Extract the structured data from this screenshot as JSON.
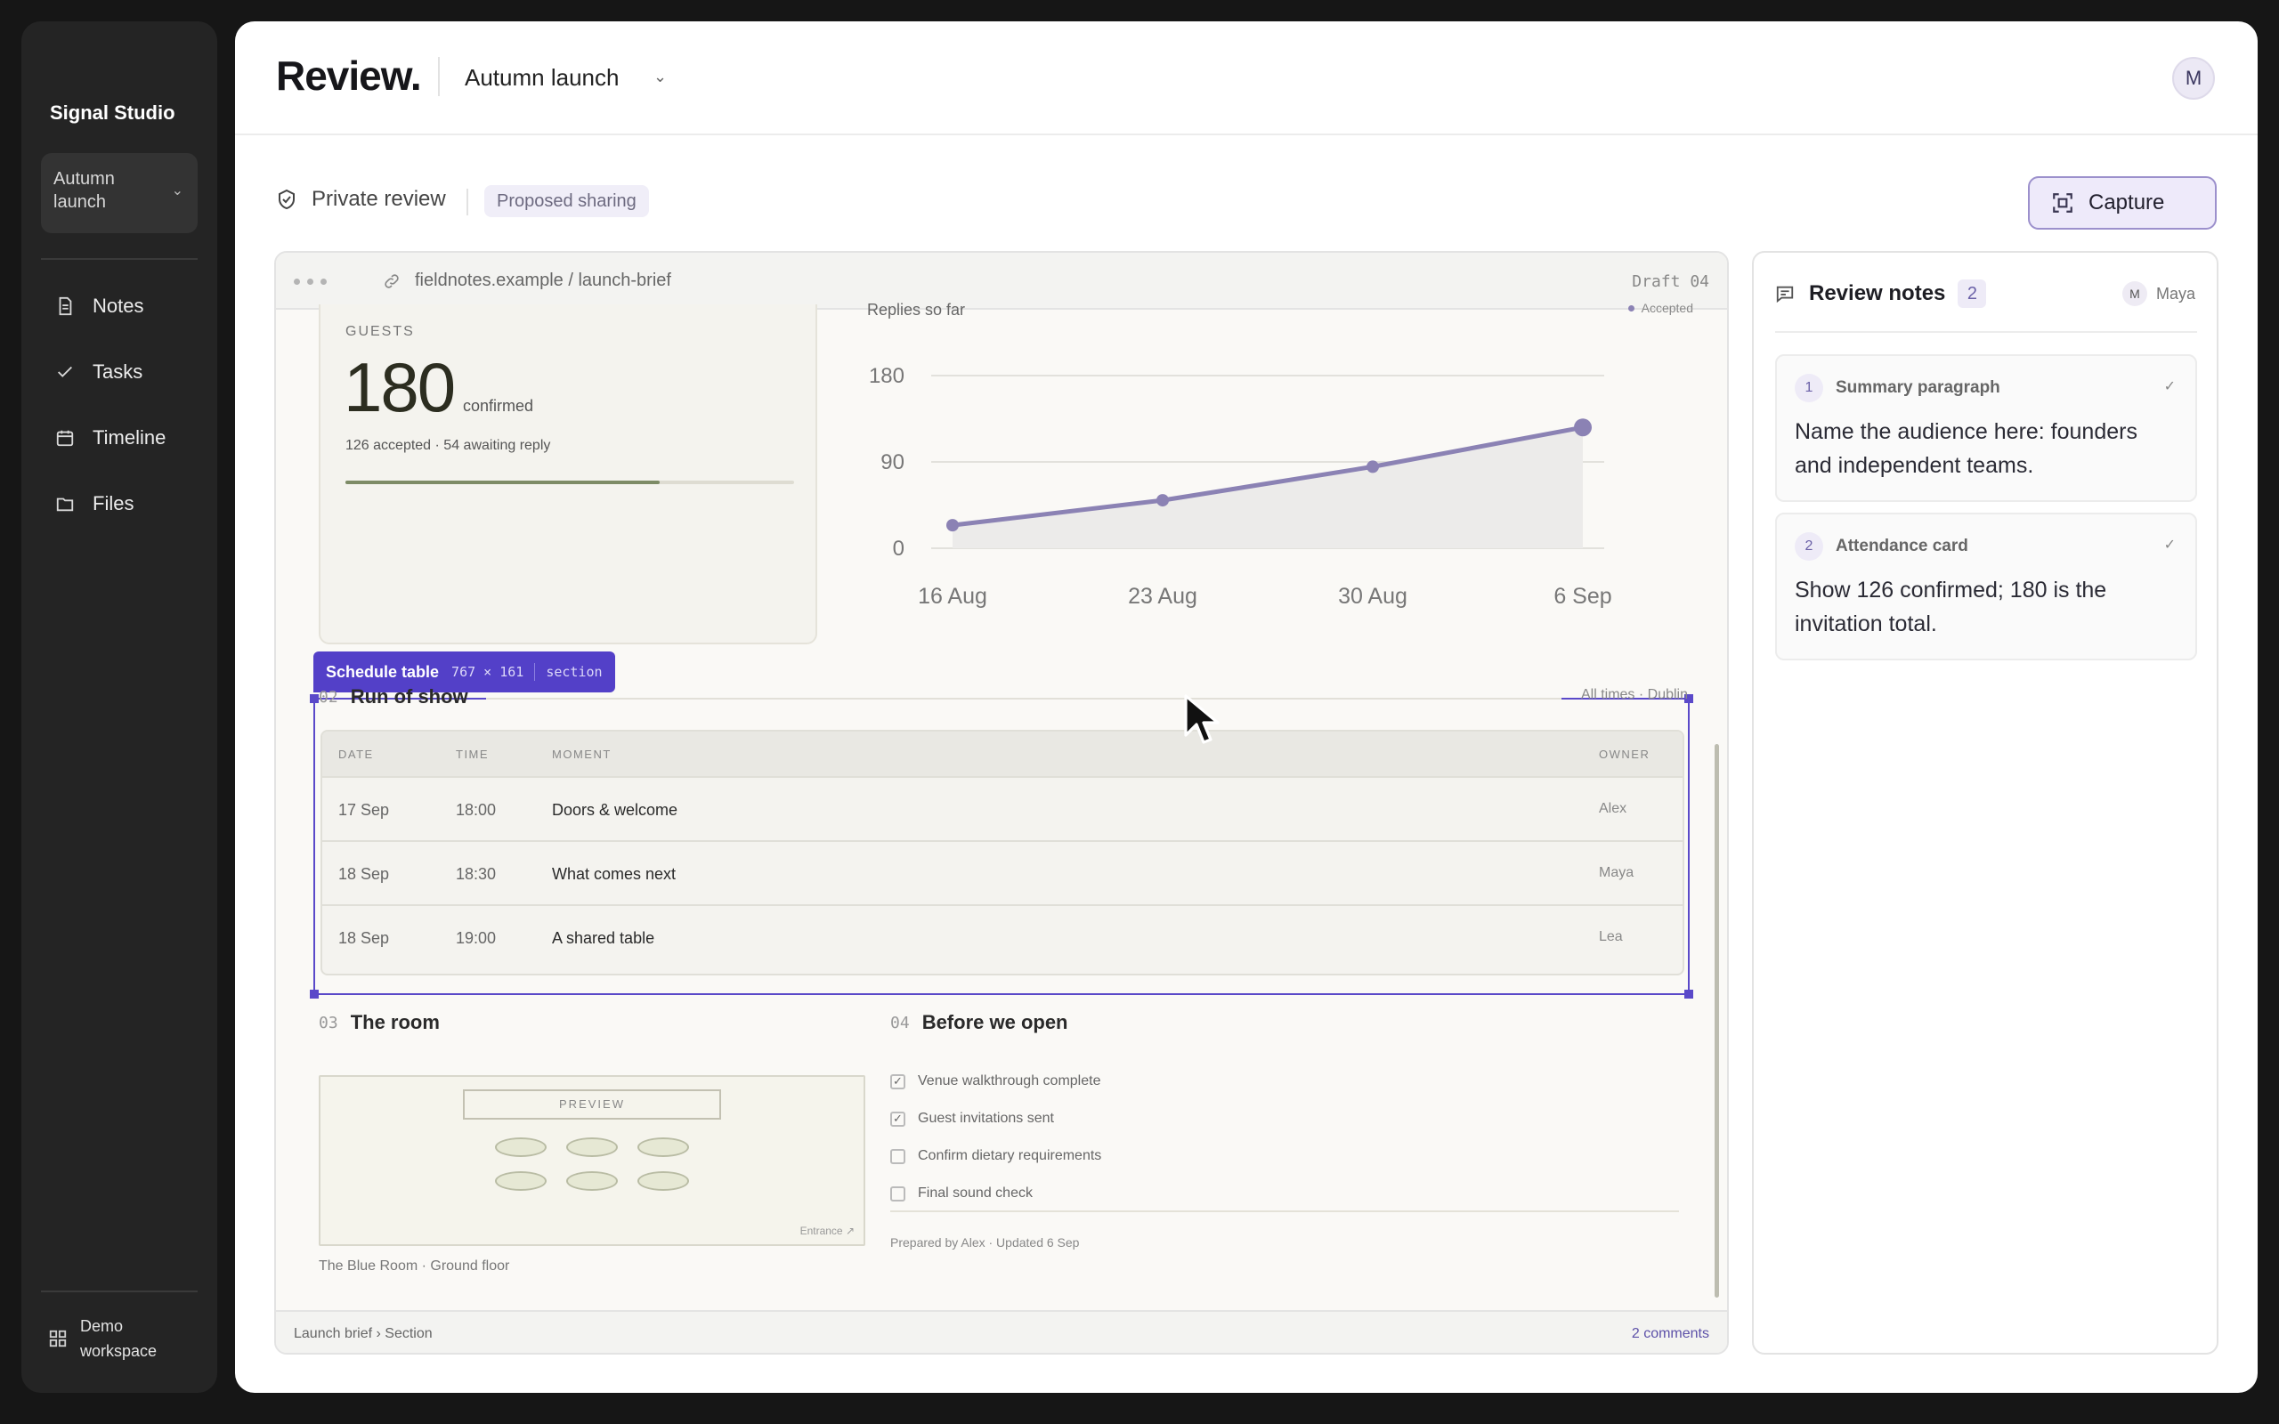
{
  "sidebar": {
    "brand": "Signal Studio",
    "project": "Autumn launch",
    "items": [
      {
        "label": "Notes",
        "icon": "document-icon"
      },
      {
        "label": "Tasks",
        "icon": "check-icon"
      },
      {
        "label": "Timeline",
        "icon": "calendar-icon"
      },
      {
        "label": "Files",
        "icon": "folder-icon"
      }
    ],
    "workspace": "Demo workspace"
  },
  "header": {
    "title": "Review.",
    "project": "Autumn launch",
    "avatar": "M"
  },
  "toolbar": {
    "mode": "Private review",
    "badge": "Proposed sharing",
    "capture": "Capture"
  },
  "browser": {
    "url": "fieldnotes.example / launch-brief",
    "draft": "Draft 04",
    "breadcrumb": "Launch brief › Section",
    "comments": "2 comments"
  },
  "guests": {
    "label": "GUESTS",
    "total": "180",
    "total_suffix": "confirmed",
    "sub": "126 accepted  ·  54 awaiting reply",
    "progress": 0.7
  },
  "replies": {
    "title": "Replies so far",
    "legend": "Accepted"
  },
  "chart_data": {
    "type": "line",
    "title": "Replies so far",
    "categories": [
      "16 Aug",
      "23 Aug",
      "30 Aug",
      "6 Sep"
    ],
    "x": [
      0,
      7,
      14,
      21
    ],
    "y_ticks": [
      "180",
      "90",
      "0"
    ],
    "ylim": [
      0,
      180
    ],
    "series": [
      {
        "name": "Accepted",
        "values": [
          24,
          50,
          85,
          126
        ],
        "color": "#8b82b4"
      }
    ],
    "grid": true,
    "legend": "top-right"
  },
  "selection": {
    "name": "Schedule table",
    "size": "767 × 161",
    "kind": "section"
  },
  "schedule": {
    "num": "02",
    "title": "Run of show",
    "note": "All times · Dublin",
    "columns": [
      "DATE",
      "TIME",
      "MOMENT",
      "OWNER"
    ],
    "rows": [
      {
        "date": "17 Sep",
        "time": "18:00",
        "moment": "Doors & welcome",
        "owner": "Alex"
      },
      {
        "date": "18 Sep",
        "time": "18:30",
        "moment": "What comes next",
        "owner": "Maya"
      },
      {
        "date": "18 Sep",
        "time": "19:00",
        "moment": "A shared table",
        "owner": "Lea"
      }
    ]
  },
  "room": {
    "num": "03",
    "title": "The room",
    "preview": "PREVIEW",
    "entrance": "Entrance ↗",
    "caption": "The Blue Room · Ground floor"
  },
  "checklist": {
    "num": "04",
    "title": "Before we open",
    "items": [
      {
        "label": "Venue walkthrough complete",
        "checked": true
      },
      {
        "label": "Guest invitations sent",
        "checked": true
      },
      {
        "label": "Confirm dietary requirements",
        "checked": false
      },
      {
        "label": "Final sound check",
        "checked": false
      }
    ],
    "footer": "Prepared by Alex   ·   Updated 6 Sep"
  },
  "notes": {
    "title": "Review notes",
    "count": "2",
    "user_initial": "M",
    "user": "Maya",
    "items": [
      {
        "num": "1",
        "label": "Summary paragraph",
        "text": "Name the audience here: founders and independent teams."
      },
      {
        "num": "2",
        "label": "Attendance card",
        "text": "Show 126 confirmed; 180 is the invitation total."
      }
    ]
  }
}
